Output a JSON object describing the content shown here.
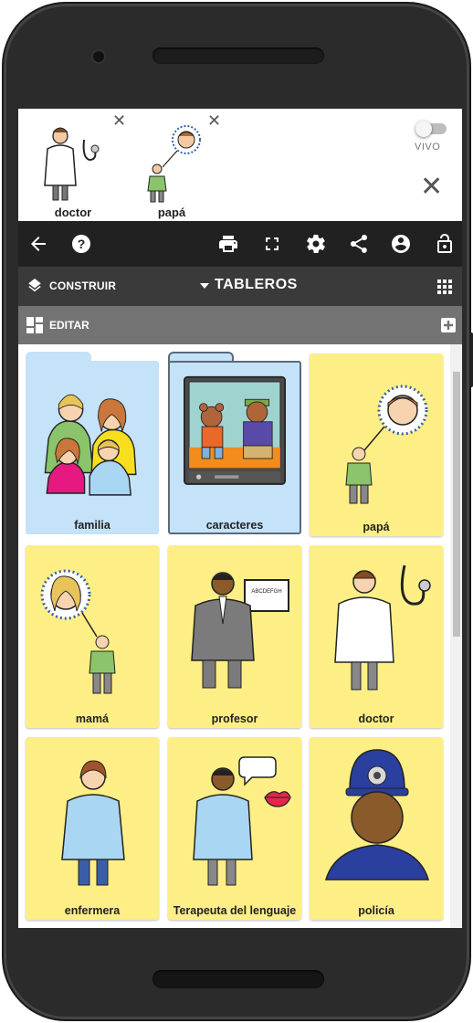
{
  "sentence_bar": {
    "items": [
      {
        "label": "doctor"
      },
      {
        "label": "papá"
      }
    ],
    "live_toggle_label": "VIVO",
    "live_toggle_on": false
  },
  "toolbar": {
    "icons": [
      "back-arrow-icon",
      "help-icon",
      "print-icon",
      "fullscreen-icon",
      "settings-icon",
      "share-icon",
      "account-icon",
      "lock-icon"
    ]
  },
  "nav": {
    "build_label": "CONSTRUIR",
    "boards_label": "TABLEROS"
  },
  "edit_bar": {
    "edit_label": "EDITAR"
  },
  "tiles": [
    {
      "label": "familia",
      "type": "folder",
      "color": "#c4e2f8"
    },
    {
      "label": "caracteres",
      "type": "folder",
      "color": "#c4e2f8"
    },
    {
      "label": "papá",
      "type": "symbol",
      "color": "#fdef86"
    },
    {
      "label": "mamá",
      "type": "symbol",
      "color": "#fdef86"
    },
    {
      "label": "profesor",
      "type": "symbol",
      "color": "#fdef86"
    },
    {
      "label": "doctor",
      "type": "symbol",
      "color": "#fdef86"
    },
    {
      "label": "enfermera",
      "type": "symbol",
      "color": "#fdef86"
    },
    {
      "label": "Terapeuta del lenguaje",
      "type": "symbol",
      "color": "#fdef86"
    },
    {
      "label": "policía",
      "type": "symbol",
      "color": "#fdef86"
    }
  ],
  "board_text": {
    "alphabet_sign": "ABCDEFGH"
  },
  "colors": {
    "toolbar_bg": "#212121",
    "nav_bg": "#3a3a3a",
    "edit_bg": "#737373",
    "symbol_tile": "#fdef86",
    "folder_tile": "#c4e2f8"
  }
}
